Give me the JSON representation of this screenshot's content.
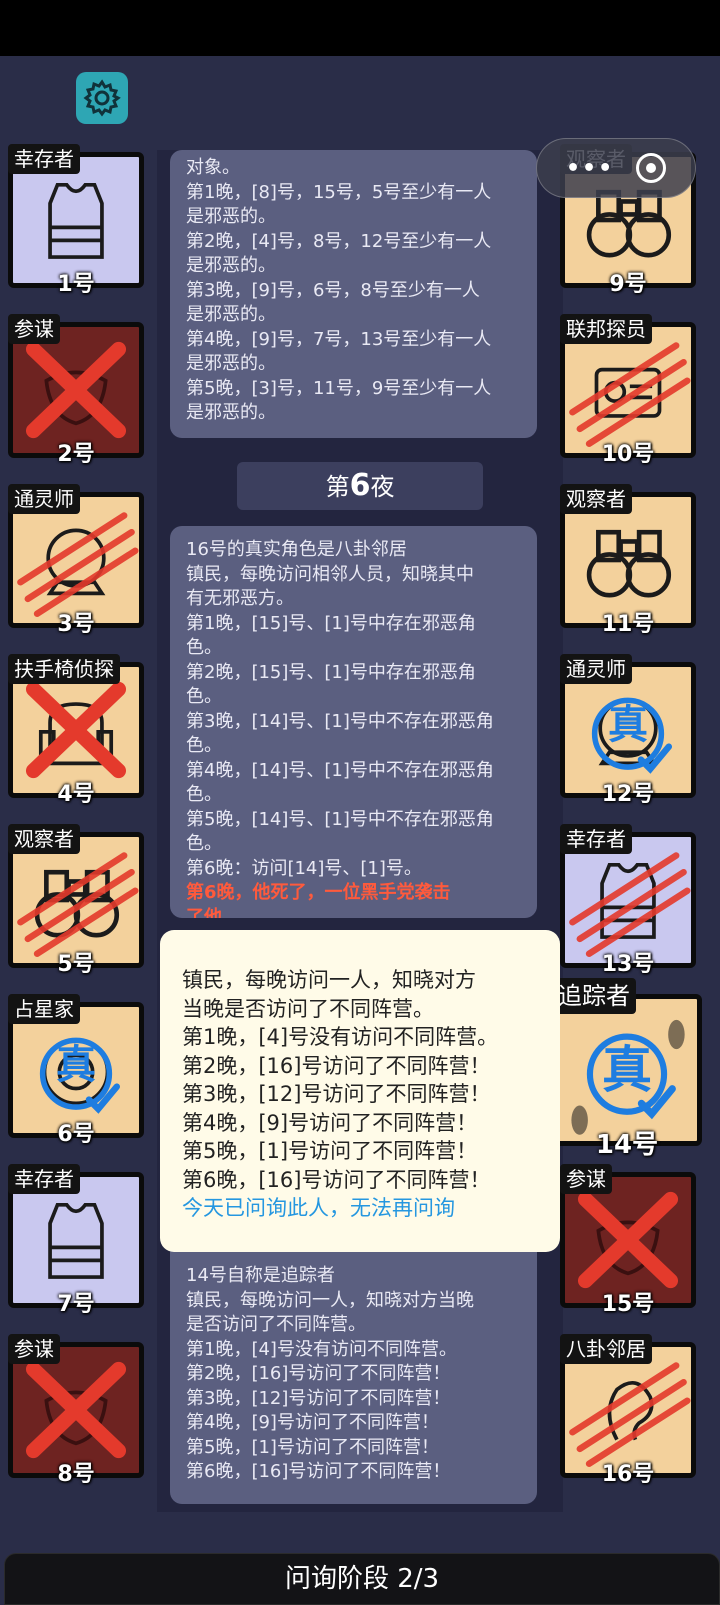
{
  "header": {
    "settings_icon": "gear-icon",
    "capsule": {
      "more_icon": "more-dots-icon",
      "close_icon": "target-close-icon"
    }
  },
  "players": [
    {
      "id": 1,
      "role": "幸存者",
      "label": "1号",
      "icon": "vest-icon",
      "mark": "",
      "color": "lavender"
    },
    {
      "id": 2,
      "role": "参谋",
      "label": "2号",
      "icon": "mask-icon",
      "mark": "red-x",
      "color": "dark-red"
    },
    {
      "id": 3,
      "role": "通灵师",
      "label": "3号",
      "icon": "crystal-ball-icon",
      "mark": "claw-scratch",
      "color": "tan"
    },
    {
      "id": 4,
      "role": "扶手椅侦探",
      "label": "4号",
      "icon": "armchair-icon",
      "mark": "red-x",
      "color": "tan"
    },
    {
      "id": 5,
      "role": "观察者",
      "label": "5号",
      "icon": "binoculars-icon",
      "mark": "claw-scratch",
      "color": "tan"
    },
    {
      "id": 6,
      "role": "占星家",
      "label": "6号",
      "icon": "astrolabe-icon",
      "mark": "真",
      "color": "tan"
    },
    {
      "id": 7,
      "role": "幸存者",
      "label": "7号",
      "icon": "vest-icon",
      "mark": "",
      "color": "lavender"
    },
    {
      "id": 8,
      "role": "参谋",
      "label": "8号",
      "icon": "mask-icon",
      "mark": "red-x",
      "color": "dark-red"
    },
    {
      "id": 9,
      "role": "观察者",
      "label": "9号",
      "icon": "binoculars-icon",
      "mark": "",
      "color": "tan"
    },
    {
      "id": 10,
      "role": "联邦探员",
      "label": "10号",
      "icon": "badge-icon",
      "mark": "claw-scratch",
      "color": "tan"
    },
    {
      "id": 11,
      "role": "观察者",
      "label": "11号",
      "icon": "binoculars-icon",
      "mark": "",
      "color": "tan"
    },
    {
      "id": 12,
      "role": "通灵师",
      "label": "12号",
      "icon": "crystal-ball-icon",
      "mark": "真",
      "color": "tan"
    },
    {
      "id": 13,
      "role": "幸存者",
      "label": "13号",
      "icon": "vest-icon",
      "mark": "claw-scratch",
      "color": "lavender"
    },
    {
      "id": 14,
      "role": "追踪者",
      "label": "14号",
      "icon": "footprints-icon",
      "mark": "真",
      "color": "tan"
    },
    {
      "id": 15,
      "role": "参谋",
      "label": "15号",
      "icon": "mask-icon",
      "mark": "red-x",
      "color": "dark-red"
    },
    {
      "id": 16,
      "role": "八卦邻居",
      "label": "16号",
      "icon": "ear-icon",
      "mark": "claw-scratch",
      "color": "tan"
    }
  ],
  "log": {
    "panel1": [
      "对象。",
      "第1晚，[8]号，15号，5号至少有一人",
      "是邪恶的。",
      "第2晚，[4]号，8号，12号至少有一人",
      "是邪恶的。",
      "第3晚，[9]号，6号，8号至少有一人",
      "是邪恶的。",
      "第4晚，[9]号，7号，13号至少有一人",
      "是邪恶的。",
      "第5晚，[3]号，11号，9号至少有一人",
      "是邪恶的。"
    ],
    "night_prefix": "第",
    "night_number": "6",
    "night_suffix": "夜",
    "panel2": [
      "16号的真实角色是八卦邻居",
      "镇民，每晚访问相邻人员，知晓其中",
      "有无邪恶方。",
      "第1晚，[15]号、[1]号中存在邪恶角",
      "色。",
      "第2晚，[15]号、[1]号中存在邪恶角",
      "色。",
      "第3晚，[14]号、[1]号中不存在邪恶角",
      "色。",
      "第4晚，[14]号、[1]号中不存在邪恶角",
      "色。",
      "第5晚，[14]号、[1]号中不存在邪恶角",
      "色。",
      "第6晚：访问[14]号、[1]号。"
    ],
    "panel2_death": [
      "第6晚，他死了，一位黑手党袭击",
      "了他。"
    ],
    "panel3": [
      "14号自称是追踪者",
      "镇民，每晚访问一人，知晓对方当晚",
      "是否访问了不同阵营。",
      "第1晚，[4]号没有访问不同阵营。",
      "第2晚，[16]号访问了不同阵营！",
      "第3晚，[12]号访问了不同阵营！",
      "第4晚，[9]号访问了不同阵营！",
      "第5晚，[1]号访问了不同阵营！",
      "第6晚，[16]号访问了不同阵营！"
    ]
  },
  "popup": {
    "lines": [
      "镇民，每晚访问一人，知晓对方",
      "当晚是否访问了不同阵营。",
      "第1晚，[4]号没有访问不同阵营。",
      "第2晚，[16]号访问了不同阵营！",
      "第3晚，[12]号访问了不同阵营！",
      "第4晚，[9]号访问了不同阵营！",
      "第5晚，[1]号访问了不同阵营！",
      "第6晚，[16]号访问了不同阵营！"
    ],
    "notice": "今天已问询此人，无法再问询"
  },
  "footer": {
    "phase": "问询阶段 2/3"
  },
  "colors": {
    "tan": "#f3d19c",
    "lavender": "#c9c8ef",
    "dark_red": "#6e2321",
    "accent_red": "#ff5a3c",
    "accent_blue": "#2597e0",
    "teal": "#2ea6b4"
  }
}
